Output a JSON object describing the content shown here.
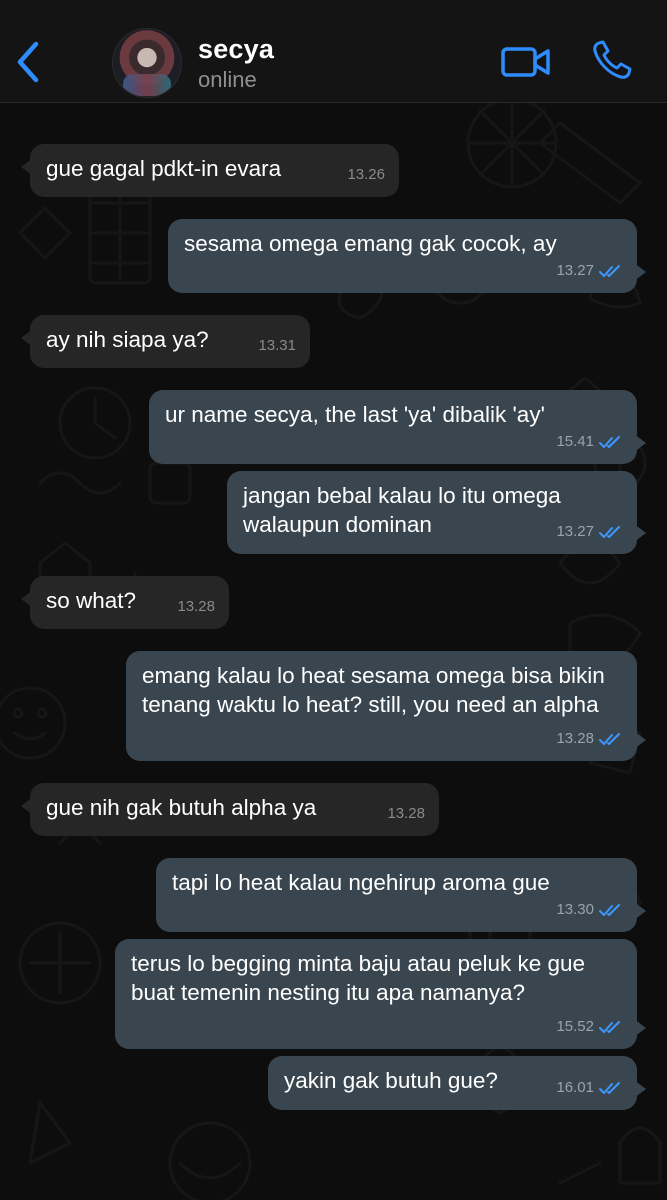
{
  "header": {
    "contact_name": "secya",
    "status": "online"
  },
  "icons": {
    "back": "chevron-left-icon",
    "video": "video-camera-icon",
    "phone": "phone-icon",
    "read": "double-check-icon"
  },
  "colors": {
    "accent": "#2f8cff",
    "incoming_bubble": "#262626",
    "outgoing_bubble": "#3a464f"
  },
  "messages": [
    {
      "direction": "in",
      "text": "gue gagal pdkt-in evara",
      "time": "13.26"
    },
    {
      "direction": "out",
      "text": "sesama omega emang gak cocok, ay",
      "time": "13.27"
    },
    {
      "direction": "in",
      "text": "ay nih siapa ya?",
      "time": "13.31"
    },
    {
      "direction": "out",
      "text": "ur name secya, the last 'ya' dibalik 'ay'",
      "time": "15.41"
    },
    {
      "direction": "out",
      "text": "jangan bebal kalau lo itu omega walaupun dominan",
      "time": "13.27"
    },
    {
      "direction": "in",
      "text": "so what?",
      "time": "13.28"
    },
    {
      "direction": "out",
      "text": "emang kalau lo heat sesama omega bisa bikin tenang waktu lo heat? still, you need an alpha",
      "time": "13.28"
    },
    {
      "direction": "in",
      "text": "gue nih gak butuh alpha ya",
      "time": "13.28"
    },
    {
      "direction": "out",
      "text": "tapi lo heat kalau ngehirup aroma gue",
      "time": "13.30"
    },
    {
      "direction": "out",
      "text": "terus lo begging minta baju atau peluk ke gue buat temenin nesting itu apa namanya?",
      "time": "15.52"
    },
    {
      "direction": "out",
      "text": "yakin gak butuh gue?",
      "time": "16.01"
    }
  ]
}
